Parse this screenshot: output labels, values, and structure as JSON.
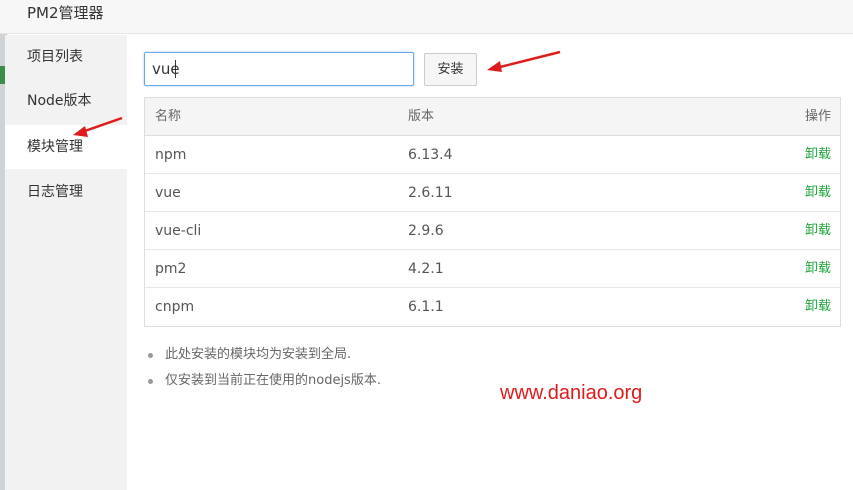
{
  "window": {
    "title": "PM2管理器"
  },
  "sidebar": {
    "items": [
      {
        "label": "项目列表",
        "active": false
      },
      {
        "label": "Node版本",
        "active": false
      },
      {
        "label": "模块管理",
        "active": true
      },
      {
        "label": "日志管理",
        "active": false
      }
    ]
  },
  "search": {
    "value": "vue",
    "placeholder": ""
  },
  "install_button": {
    "label": "安装"
  },
  "table": {
    "headers": {
      "name": "名称",
      "version": "版本",
      "action": "操作"
    },
    "rows": [
      {
        "name": "npm",
        "version": "6.13.4",
        "action": "卸载"
      },
      {
        "name": "vue",
        "version": "2.6.11",
        "action": "卸载"
      },
      {
        "name": "vue-cli",
        "version": "2.9.6",
        "action": "卸载"
      },
      {
        "name": "pm2",
        "version": "4.2.1",
        "action": "卸载"
      },
      {
        "name": "cnpm",
        "version": "6.1.1",
        "action": "卸载"
      }
    ]
  },
  "notes": [
    "此处安装的模块均为安装到全局.",
    "仅安装到当前正在使用的nodejs版本."
  ],
  "watermark": "www.daniao.org",
  "colors": {
    "action_green": "#20a53a",
    "annotation_red": "#e01b1b",
    "focus_blue": "#6aa7e6"
  }
}
